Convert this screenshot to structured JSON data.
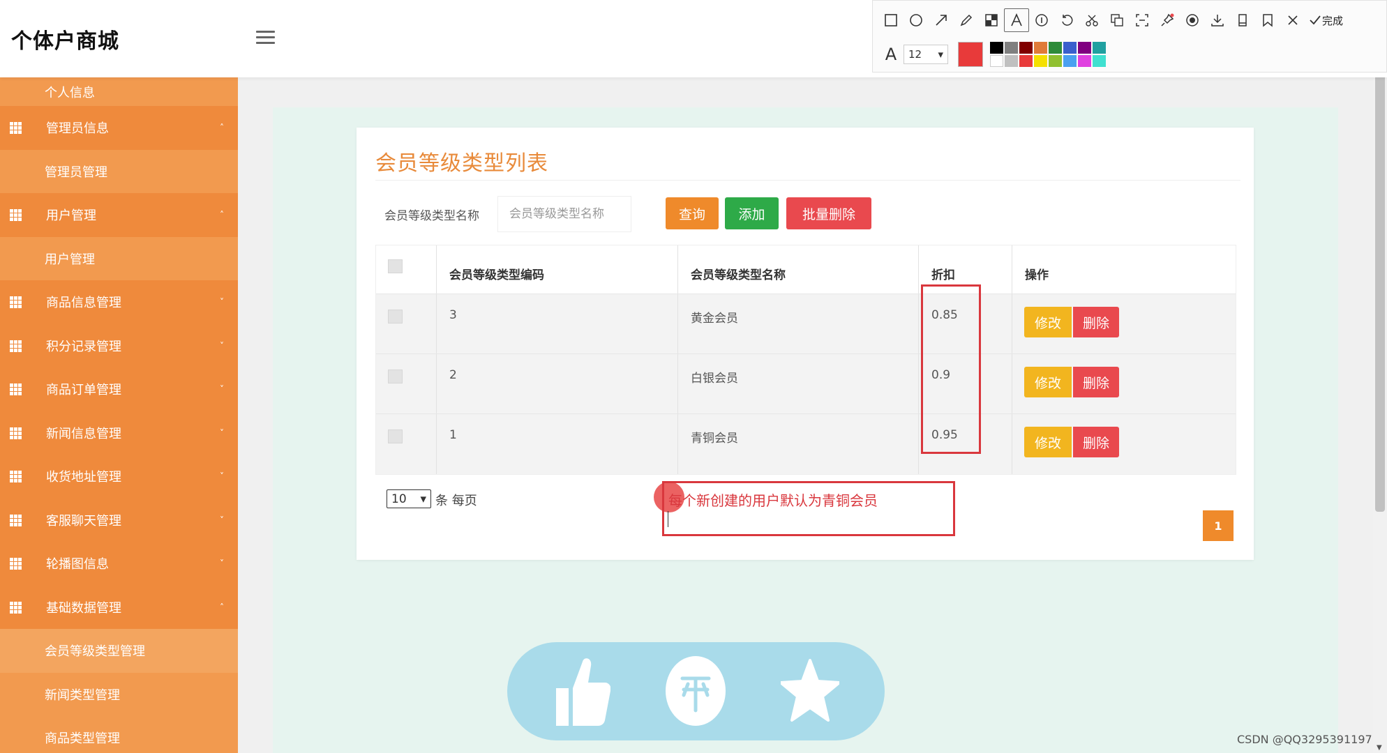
{
  "header": {
    "brand": "个体户商城",
    "avatar_text": "80x80"
  },
  "sidebar": {
    "items": [
      {
        "type": "child",
        "label": "个人信息"
      },
      {
        "type": "parent",
        "label": "管理员信息",
        "chevron": "˄"
      },
      {
        "type": "child",
        "label": "管理员管理"
      },
      {
        "type": "parent",
        "label": "用户管理",
        "chevron": "˄"
      },
      {
        "type": "child",
        "label": "用户管理"
      },
      {
        "type": "parent",
        "label": "商品信息管理",
        "chevron": "˅"
      },
      {
        "type": "parent",
        "label": "积分记录管理",
        "chevron": "˅"
      },
      {
        "type": "parent",
        "label": "商品订单管理",
        "chevron": "˅"
      },
      {
        "type": "parent",
        "label": "新闻信息管理",
        "chevron": "˅"
      },
      {
        "type": "parent",
        "label": "收货地址管理",
        "chevron": "˅"
      },
      {
        "type": "parent",
        "label": "客服聊天管理",
        "chevron": "˅"
      },
      {
        "type": "parent",
        "label": "轮播图信息",
        "chevron": "˅"
      },
      {
        "type": "parent",
        "label": "基础数据管理",
        "chevron": "˄"
      },
      {
        "type": "child",
        "label": "会员等级类型管理",
        "active": true
      },
      {
        "type": "child",
        "label": "新闻类型管理"
      },
      {
        "type": "child",
        "label": "商品类型管理"
      }
    ]
  },
  "page": {
    "title": "会员等级类型列表",
    "search": {
      "label": "会员等级类型名称",
      "placeholder": "会员等级类型名称",
      "value": ""
    },
    "buttons": {
      "query": "查询",
      "add": "添加",
      "batch_delete": "批量删除"
    },
    "table": {
      "headers": [
        "会员等级类型编码",
        "会员等级类型名称",
        "折扣",
        "操作"
      ],
      "rows": [
        {
          "code": "3",
          "name": "黄金会员",
          "discount": "0.85"
        },
        {
          "code": "2",
          "name": "白银会员",
          "discount": "0.9"
        },
        {
          "code": "1",
          "name": "青铜会员",
          "discount": "0.95"
        }
      ],
      "edit_label": "修改",
      "delete_label": "删除"
    },
    "pager": {
      "page_size": "10",
      "per_page_text": "条 每页",
      "current_page": "1"
    }
  },
  "annotation": {
    "note": "每个新创建的用户默认为青铜会员",
    "color": "#d9373d"
  },
  "snap_toolbar": {
    "done_label": "完成",
    "font_size": "12",
    "current_color": "#e83a3a",
    "palette": [
      "#000000",
      "#808080",
      "#800000",
      "#e07b39",
      "#2e8b3a",
      "#3a5fcd",
      "#800080",
      "#20a0a0",
      "#ffffff",
      "#c0c0c0",
      "#e83a3a",
      "#f5e000",
      "#90c030",
      "#4aa0f0",
      "#e040e0",
      "#40e0d0"
    ]
  },
  "watermark": "CSDN @QQ3295391197",
  "colors": {
    "sidebar": "#ef8a3c",
    "accent_orange": "#ef8a2b",
    "success_green": "#2eaa48",
    "danger_red": "#e9494e",
    "warning_yellow": "#f2b51f",
    "main_bg": "#e6f4ef"
  }
}
